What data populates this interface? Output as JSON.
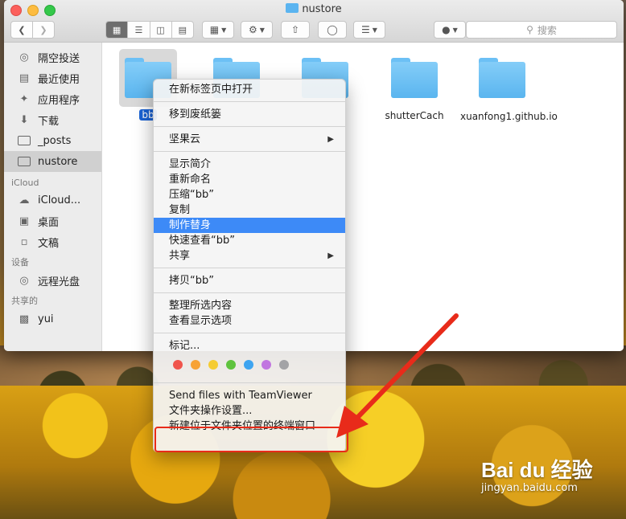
{
  "window": {
    "title": "nustore"
  },
  "toolbar": {
    "search_placeholder": "搜索"
  },
  "sidebar": {
    "favorites": [
      {
        "label": "隔空投送",
        "icon": "airdrop-icon"
      },
      {
        "label": "最近使用",
        "icon": "recent-icon"
      },
      {
        "label": "应用程序",
        "icon": "applications-icon"
      },
      {
        "label": "下载",
        "icon": "download-icon"
      },
      {
        "label": "_posts",
        "icon": "folder-icon"
      },
      {
        "label": "nustore",
        "icon": "folder-icon",
        "selected": true
      }
    ],
    "icloud_header": "iCloud",
    "icloud": [
      {
        "label": "iCloud...",
        "icon": "cloud-icon"
      },
      {
        "label": "桌面",
        "icon": "desktop-icon"
      },
      {
        "label": "文稿",
        "icon": "document-icon"
      }
    ],
    "devices_header": "设备",
    "devices": [
      {
        "label": "远程光盘",
        "icon": "disc-icon"
      }
    ],
    "shared_header": "共享的",
    "shared": [
      {
        "label": "yui",
        "icon": "computer-icon"
      }
    ]
  },
  "files": [
    {
      "name": "bb",
      "selected": true
    },
    {
      "name": ""
    },
    {
      "name": ""
    },
    {
      "name": "shutterCach"
    },
    {
      "name": "xuanfong1.github.io"
    }
  ],
  "menu": {
    "open_new_tab": "在新标签页中打开",
    "move_trash": "移到废纸篓",
    "jianguoyun": "坚果云",
    "get_info": "显示简介",
    "rename": "重新命名",
    "compress": "压缩“bb”",
    "duplicate": "复制",
    "make_alias": "制作替身",
    "quick_look": "快速查看“bb”",
    "share": "共享",
    "copy": "拷贝“bb”",
    "clean_up": "整理所选内容",
    "view_options": "查看显示选项",
    "tags": "标记...",
    "tag_colors": [
      "#f0544c",
      "#f7a235",
      "#f5cc32",
      "#5fc33e",
      "#3ea4f0",
      "#c176e0",
      "#a3a3a6"
    ],
    "teamviewer": "Send files with TeamViewer",
    "folder_actions": "文件夹操作设置...",
    "new_terminal": "新建位于文件夹位置的终端窗口"
  },
  "watermark": {
    "brand": "Bai du 经验",
    "url": "jingyan.baidu.com"
  }
}
